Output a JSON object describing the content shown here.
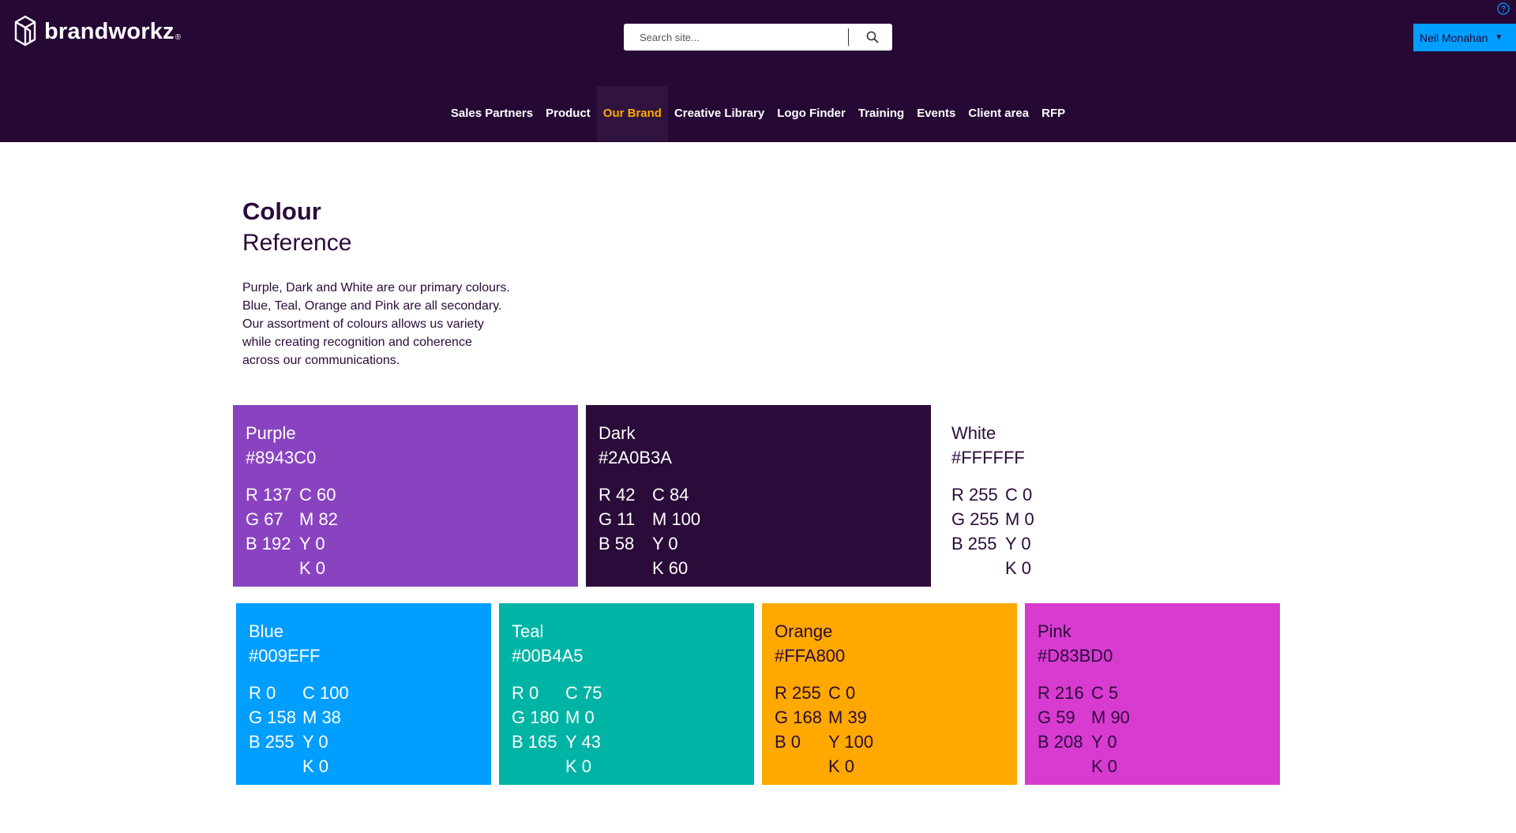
{
  "header": {
    "logo_text": "brandworkz",
    "logo_mark": "®",
    "search": {
      "placeholder": "Search site..."
    },
    "user": {
      "name": "Neil Monahan",
      "caret": "▼"
    },
    "nav": [
      {
        "label": "Sales Partners",
        "active": false
      },
      {
        "label": "Product",
        "active": false
      },
      {
        "label": "Our Brand",
        "active": true
      },
      {
        "label": "Creative Library",
        "active": false
      },
      {
        "label": "Logo Finder",
        "active": false
      },
      {
        "label": "Training",
        "active": false
      },
      {
        "label": "Events",
        "active": false
      },
      {
        "label": "Client area",
        "active": false
      },
      {
        "label": "RFP",
        "active": false
      }
    ],
    "icons": {
      "logo": "cube-logo-icon",
      "search": "search-icon",
      "help": "help-icon"
    },
    "colors": {
      "background": "#260834",
      "accent": "#FFA800",
      "user_button": "#009EFF"
    }
  },
  "main": {
    "title_bold": "Colour",
    "title_light": "Reference",
    "intro_lines": [
      "Purple, Dark and White are our primary colours.",
      "Blue, Teal, Orange and Pink are all secondary.",
      "Our assortment of colours allows us variety",
      "while creating recognition and coherence",
      "across our communications."
    ]
  },
  "swatches": [
    {
      "name": "Purple",
      "hex": "#8943C0",
      "rgb": [
        "R 137",
        "G 67",
        "B 192"
      ],
      "cmyk": [
        "C 60",
        "M 82",
        "Y 0",
        "K 0"
      ]
    },
    {
      "name": "Dark",
      "hex": "#2A0B3A",
      "rgb": [
        "R 42",
        "G 11",
        "B 58"
      ],
      "cmyk": [
        "C 84",
        "M 100",
        "Y 0",
        "K 60"
      ]
    },
    {
      "name": "White",
      "hex": "#FFFFFF",
      "rgb": [
        "R 255",
        "G 255",
        "B 255"
      ],
      "cmyk": [
        "C 0",
        "M 0",
        "Y 0",
        "K 0"
      ]
    },
    {
      "name": "Blue",
      "hex": "#009EFF",
      "rgb": [
        "R 0",
        "G 158",
        "B 255"
      ],
      "cmyk": [
        "C 100",
        "M 38",
        "Y 0",
        "K 0"
      ]
    },
    {
      "name": "Teal",
      "hex": "#00B4A5",
      "rgb": [
        "R 0",
        "G 180",
        "B 165"
      ],
      "cmyk": [
        "C 75",
        "M 0",
        "Y 43",
        "K 0"
      ]
    },
    {
      "name": "Orange",
      "hex": "#FFA800",
      "rgb": [
        "R 255",
        "G 168",
        "B 0"
      ],
      "cmyk": [
        "C 0",
        "M 39",
        "Y 100",
        "K 0"
      ]
    },
    {
      "name": "Pink",
      "hex": "#D83BD0",
      "rgb": [
        "R 216",
        "G 59",
        "B 208"
      ],
      "cmyk": [
        "C 5",
        "M 90",
        "Y 0",
        "K 0"
      ]
    }
  ]
}
